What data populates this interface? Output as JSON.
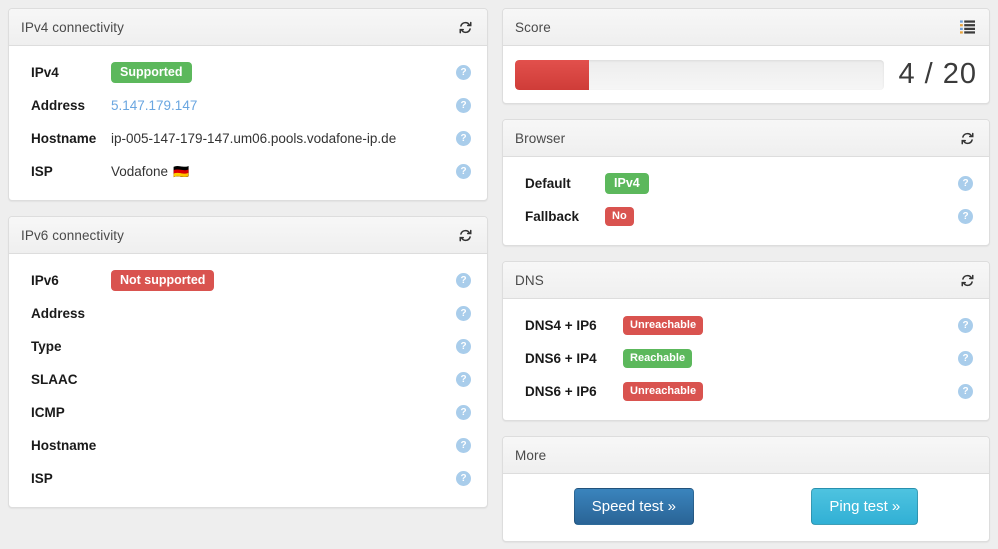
{
  "icons": {
    "refresh": "refresh-icon",
    "list": "list-icon",
    "help": "?"
  },
  "left": {
    "ipv4": {
      "title": "IPv4 connectivity",
      "rows": [
        {
          "label": "IPv4",
          "value": "Supported",
          "kind": "badge-green"
        },
        {
          "label": "Address",
          "value": "5.147.179.147",
          "kind": "link"
        },
        {
          "label": "Hostname",
          "value": "ip-005-147-179-147.um06.pools.vodafone-ip.de",
          "kind": "text"
        },
        {
          "label": "ISP",
          "value": "Vodafone",
          "kind": "text-flag",
          "flag": "🇩🇪"
        }
      ]
    },
    "ipv6": {
      "title": "IPv6 connectivity",
      "rows": [
        {
          "label": "IPv6",
          "value": "Not supported",
          "kind": "badge-red"
        },
        {
          "label": "Address",
          "value": "",
          "kind": "text"
        },
        {
          "label": "Type",
          "value": "",
          "kind": "text"
        },
        {
          "label": "SLAAC",
          "value": "",
          "kind": "text"
        },
        {
          "label": "ICMP",
          "value": "",
          "kind": "text"
        },
        {
          "label": "Hostname",
          "value": "",
          "kind": "text"
        },
        {
          "label": "ISP",
          "value": "",
          "kind": "text"
        }
      ]
    }
  },
  "right": {
    "score": {
      "title": "Score",
      "value": 4,
      "max": 20,
      "display": "4 / 20",
      "percent": 20,
      "bar_color": "#d9534f"
    },
    "browser": {
      "title": "Browser",
      "rows": [
        {
          "label": "Default",
          "value": "IPv4",
          "kind": "badge-green"
        },
        {
          "label": "Fallback",
          "value": "No",
          "kind": "badge-red"
        }
      ]
    },
    "dns": {
      "title": "DNS",
      "rows": [
        {
          "label": "DNS4 + IP6",
          "value": "Unreachable",
          "kind": "badge-red"
        },
        {
          "label": "DNS6 + IP4",
          "value": "Reachable",
          "kind": "badge-green"
        },
        {
          "label": "DNS6 + IP6",
          "value": "Unreachable",
          "kind": "badge-red"
        }
      ]
    },
    "more": {
      "title": "More",
      "speed_test": "Speed test »",
      "ping_test": "Ping test »"
    }
  }
}
